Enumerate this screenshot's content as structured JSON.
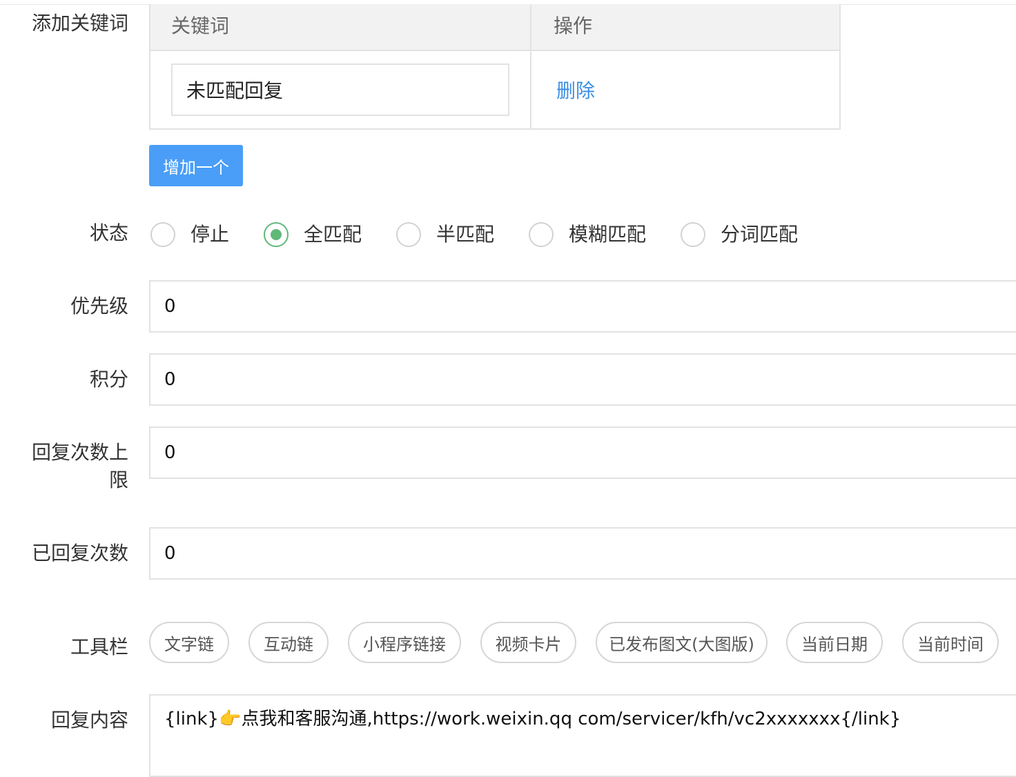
{
  "keywords": {
    "label": "添加关键词",
    "col_keyword": "关键词",
    "col_action": "操作",
    "rows": [
      {
        "value": "未匹配回复",
        "action": "删除"
      }
    ],
    "add_button": "增加一个"
  },
  "status": {
    "label": "状态",
    "options": [
      {
        "label": "停止",
        "checked": false
      },
      {
        "label": "全匹配",
        "checked": true
      },
      {
        "label": "半匹配",
        "checked": false
      },
      {
        "label": "模糊匹配",
        "checked": false
      },
      {
        "label": "分词匹配",
        "checked": false
      }
    ],
    "accent_color": "#5fb878"
  },
  "fields": {
    "priority": {
      "label": "优先级",
      "value": "0"
    },
    "points": {
      "label": "积分",
      "value": "0"
    },
    "reply_limit": {
      "label": "回复次数上限",
      "value": "0"
    },
    "reply_count": {
      "label": "已回复次数",
      "value": "0"
    }
  },
  "toolbar": {
    "label": "工具栏",
    "items": [
      "文字链",
      "互动链",
      "小程序链接",
      "视频卡片",
      "已发布图文(大图版)",
      "当前日期",
      "当前时间"
    ]
  },
  "reply_content": {
    "label": "回复内容",
    "text_before": "{link}",
    "emoji": "👉",
    "text_after": "点我和客服沟通,https://work.weixin.qq com/servicer/kfh/vc2xxxxxxx{/link}"
  },
  "colors": {
    "link": "#3b8fe6",
    "button": "#4a9ef7",
    "border": "#e2e2e2",
    "header_bg": "#f2f2f2"
  }
}
